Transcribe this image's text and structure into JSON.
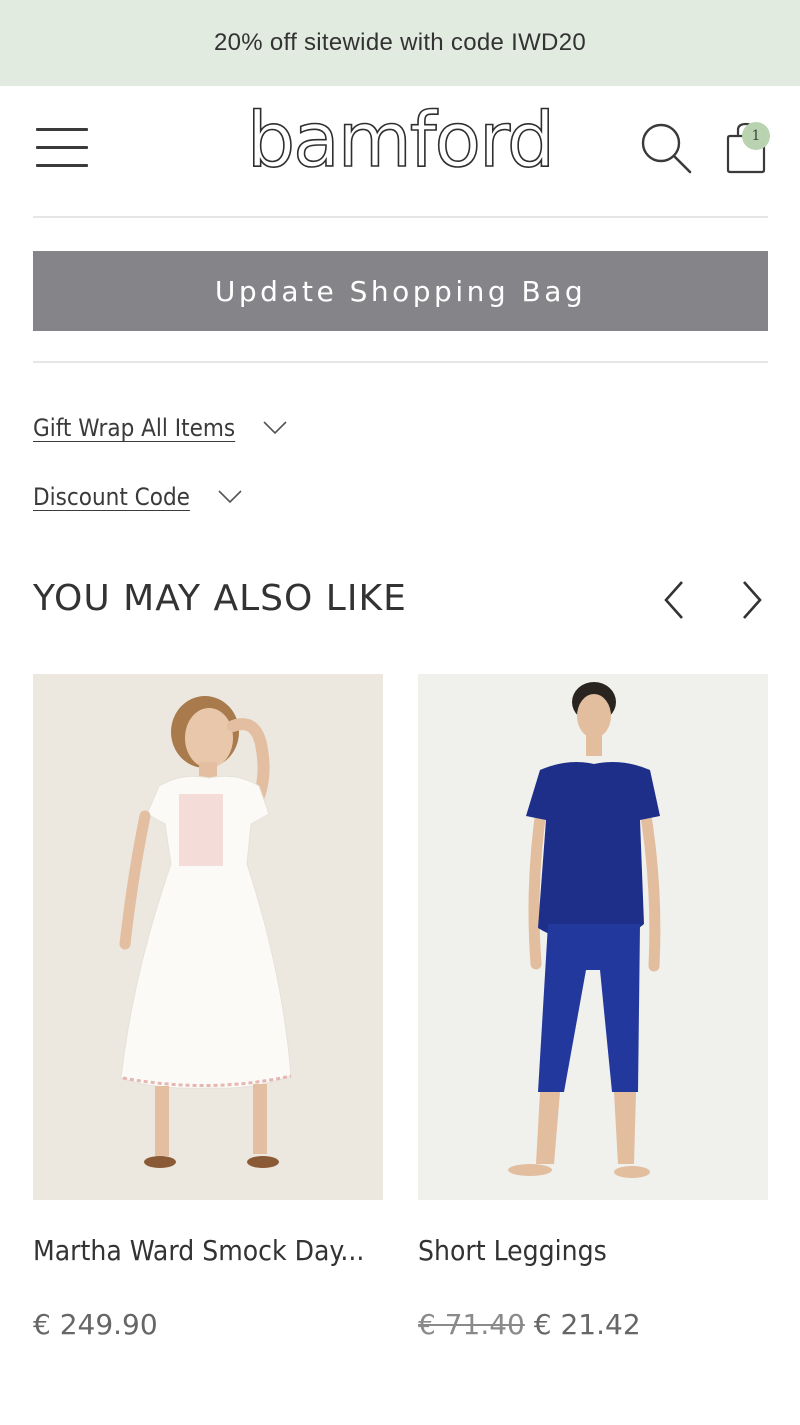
{
  "promo": {
    "text": "20% off sitewide with code IWD20"
  },
  "header": {
    "logo": "bamford",
    "bag_count": "1",
    "icons": [
      "menu-icon",
      "search-icon",
      "shopping-bag-icon"
    ]
  },
  "cart": {
    "update_button": "Update Shopping Bag",
    "gift_wrap_label": "Gift Wrap All Items",
    "discount_label": "Discount Code"
  },
  "recommendations": {
    "title": "YOU MAY ALSO LIKE",
    "products": [
      {
        "name": "Martha Ward Smock Day...",
        "price": "€ 249.90",
        "original_price": "",
        "image_bg": "#ede9e0"
      },
      {
        "name": "Short Leggings",
        "price": "€ 21.42",
        "original_price": "€ 71.40",
        "image_bg": "#f1f1ee"
      }
    ]
  },
  "colors": {
    "promo_bg": "#e2ebe0",
    "button_bg": "#858589",
    "badge_bg": "#b9d3b0",
    "leggings_navy": "#1e2f8a"
  }
}
